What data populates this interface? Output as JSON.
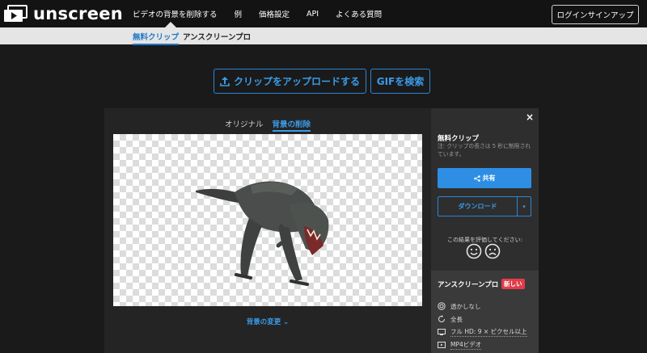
{
  "brand": {
    "name": "unscreen"
  },
  "nav": {
    "items": [
      "ビデオの背景を削除する",
      "例",
      "価格設定",
      "API",
      "よくある質問"
    ],
    "login_label": "ログインサインアップ"
  },
  "subnav": {
    "tabs": [
      "無料クリップ",
      "アンスクリーンプロ"
    ],
    "active": "無料クリップ"
  },
  "actions": {
    "upload_label": "クリップをアップロードする",
    "gif_label": "GIFを検索"
  },
  "editor": {
    "tabs": [
      "オリジナル",
      "背景の削除"
    ],
    "active_tab": "背景の削除",
    "change_bg_label": "背景の変更"
  },
  "sidepanel": {
    "close_label": "×",
    "free_title": "無料クリップ",
    "free_note": "注: クリップの長さは 5 秒に制限されています。",
    "share_label": "共有",
    "download_label": "ダウンロード",
    "rate_prompt": "この結果を評価してください:",
    "pro_title": "アンスクリーンプロ",
    "new_badge": "新しい",
    "features": [
      "透かしなし",
      "全長",
      "フル HD: 9 × ピクセル以上",
      "MP4ビデオ"
    ]
  },
  "colors": {
    "accent": "#2d8ee3",
    "badge": "#e23c4a",
    "background": "#1a1a1a",
    "subbar": "#e5e5e5"
  },
  "icons": [
    "play-logo-icon",
    "upload-icon",
    "share-icon",
    "chevron-down-icon",
    "close-icon",
    "happy-face-icon",
    "sad-face-icon",
    "no-watermark-icon",
    "full-length-icon",
    "hd-icon",
    "mp4-video-icon"
  ]
}
